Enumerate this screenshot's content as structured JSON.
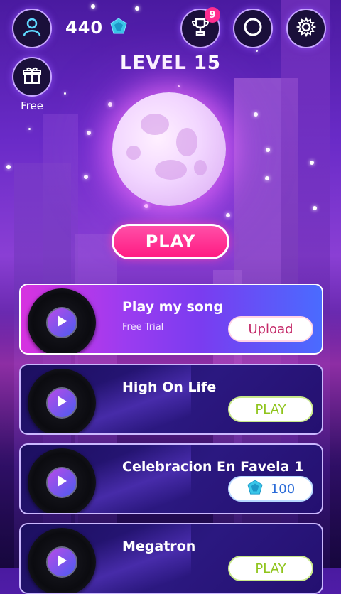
{
  "header": {
    "coins": "440",
    "level": "LEVEL 15",
    "trophy_badge": "9",
    "gift_label": "Free"
  },
  "main": {
    "play_label": "PLAY"
  },
  "songs": [
    {
      "title": "Play my song",
      "subtitle": "Free Trial",
      "action": "Upload"
    },
    {
      "title": "High On Life",
      "action": "PLAY"
    },
    {
      "title": "Celebracion En Favela 1",
      "price": "100"
    },
    {
      "title": "Megatron",
      "action": "PLAY"
    }
  ],
  "icons": [
    "profile-icon",
    "gem-icon",
    "gift-icon",
    "trophy-icon",
    "disc-icon",
    "gear-icon",
    "play-icon"
  ],
  "colors": {
    "accent_pink": "#ff1b82",
    "play_green": "#8fc41b",
    "upload_pink": "#c52b6a",
    "gem_blue": "#3ac6e8"
  }
}
